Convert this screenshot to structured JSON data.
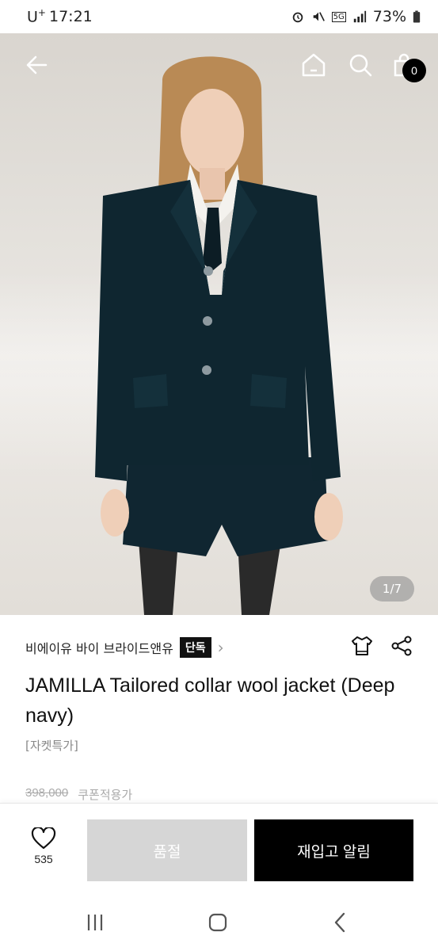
{
  "status_bar": {
    "carrier": "U",
    "carrier_sup": "+",
    "time": "17:21",
    "network": "5G",
    "battery": "73%"
  },
  "top_nav": {
    "back_icon": "arrow-left-icon",
    "home_icon": "home-icon",
    "search_icon": "search-icon",
    "cart_icon": "cart-icon",
    "cart_count": "0"
  },
  "gallery": {
    "indicator": "1/7"
  },
  "product": {
    "brand": "비에이유 바이 브라이드앤유",
    "exclusive_label": "단독",
    "title": "JAMILLA Tailored collar wool jacket (Deep navy)",
    "tag": "[자켓특가]",
    "original_price": "398,000",
    "coupon_text": "쿠폰적용가"
  },
  "action_bar": {
    "like_count": "535",
    "soldout_label": "품절",
    "restock_label": "재입고 알림"
  },
  "colors": {
    "jacket_navy": "#0f2630",
    "soldout_gray": "#d6d6d6",
    "primary_black": "#000000"
  }
}
